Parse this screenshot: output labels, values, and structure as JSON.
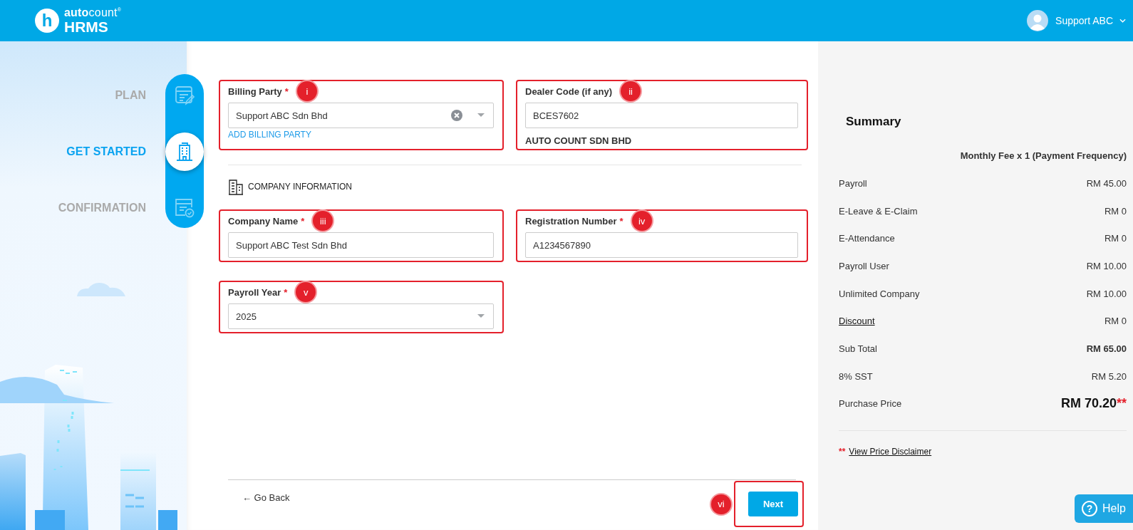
{
  "header": {
    "logo": {
      "badge": "h",
      "wordmark": "**auto**count",
      "mark": "®",
      "product": "HRMS"
    },
    "user": {
      "name": "Support ABC"
    }
  },
  "steps": [
    {
      "label": "PLAN",
      "selected": false
    },
    {
      "label": "GET STARTED",
      "selected": true
    },
    {
      "label": "CONFIRMATION",
      "selected": false
    }
  ],
  "billing_section": {
    "fields": [
      {
        "kind": "select",
        "label": "Billing Party",
        "required_mark": "*",
        "value": "Support ABC Sdn Bhd",
        "clearable": true,
        "link": "ADD BILLING PARTY",
        "callout": "i"
      },
      {
        "kind": "text",
        "label": "Dealer Code (if any)",
        "value": "BCES7602",
        "note": "AUTO COUNT SDN BHD",
        "callout": "ii"
      }
    ]
  },
  "company_section": {
    "heading": "COMPANY INFORMATION",
    "fields": [
      {
        "kind": "text",
        "label": "Company Name",
        "required_mark": "*",
        "value": "Support ABC Test Sdn Bhd",
        "callout": "iii"
      },
      {
        "kind": "text",
        "label": "Registration Number",
        "required_mark": "*",
        "value": "A1234567890",
        "callout": "iv"
      },
      {
        "kind": "select",
        "label": "Payroll Year",
        "required_mark": "*",
        "value": "2025",
        "clearable": false,
        "callout": "v"
      }
    ]
  },
  "footer": {
    "back": "← Go Back",
    "next": {
      "label": "Next",
      "callout": "vi"
    }
  },
  "summary": {
    "title": "Summary",
    "column_header": "Monthly Fee x 1 (Payment Frequency)",
    "rows": [
      {
        "label": "Payroll",
        "value": "RM 45.00",
        "kind": "plain"
      },
      {
        "label": "E-Leave & E-Claim",
        "value": "RM 0",
        "kind": "plain"
      },
      {
        "label": "E-Attendance",
        "value": "RM 0",
        "kind": "plain"
      },
      {
        "label": "Payroll User",
        "value": "RM 10.00",
        "kind": "plain"
      },
      {
        "label": "Unlimited Company",
        "value": "RM 10.00",
        "kind": "plain"
      },
      {
        "label": "Discount",
        "value": "RM 0",
        "kind": "link"
      },
      {
        "label": "Sub Total",
        "value": "RM 65.00",
        "kind": "bold"
      },
      {
        "label": "8% SST",
        "value": "RM 5.20",
        "kind": "plain"
      },
      {
        "label": "Purchase Price",
        "value": "RM 70.20",
        "value_mark": "**",
        "kind": "total"
      }
    ],
    "disclaimer": {
      "mark": "**",
      "link": "View Price Disclaimer"
    }
  },
  "help": {
    "glyph": "?",
    "label": "Help"
  }
}
